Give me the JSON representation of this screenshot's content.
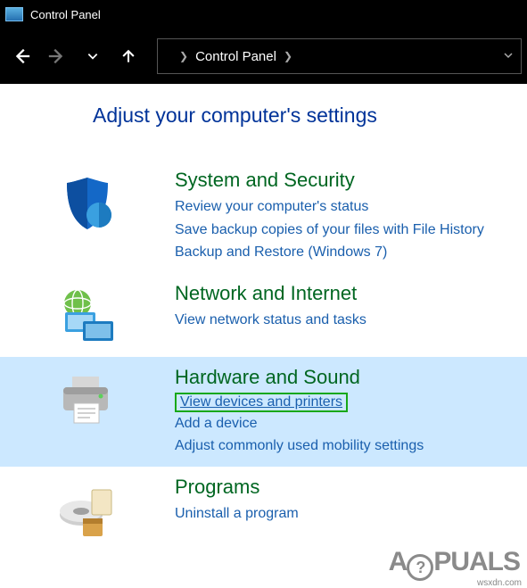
{
  "titlebar": {
    "text": "Control Panel"
  },
  "breadcrumb": {
    "text": "Control Panel"
  },
  "heading": "Adjust your computer's settings",
  "categories": [
    {
      "title": "System and Security",
      "links": [
        "Review your computer's status",
        "Save backup copies of your files with File History",
        "Backup and Restore (Windows 7)"
      ]
    },
    {
      "title": "Network and Internet",
      "links": [
        "View network status and tasks"
      ]
    },
    {
      "title": "Hardware and Sound",
      "links": [
        "View devices and printers",
        "Add a device",
        "Adjust commonly used mobility settings"
      ]
    },
    {
      "title": "Programs",
      "links": [
        "Uninstall a program"
      ]
    }
  ],
  "watermark": {
    "prefix": "A",
    "mid": "?",
    "suffix": "PUALS"
  },
  "source": "wsxdn.com"
}
